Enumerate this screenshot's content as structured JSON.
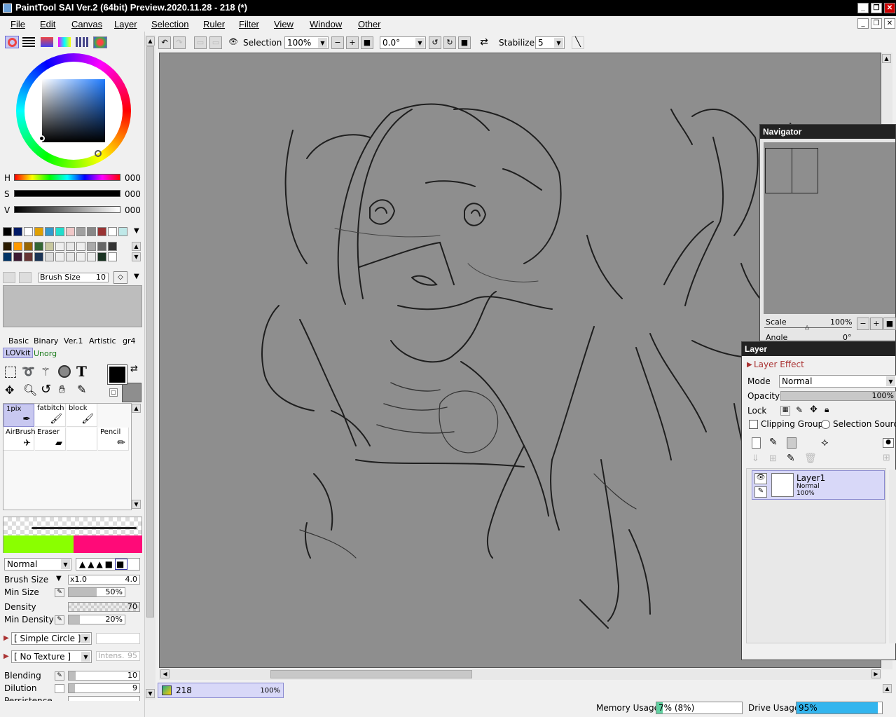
{
  "window": {
    "title": "PaintTool SAI Ver.2 (64bit) Preview.2020.11.28 - 218 (*)"
  },
  "menu": [
    "File",
    "Edit",
    "Canvas",
    "Layer",
    "Selection",
    "Ruler",
    "Filter",
    "View",
    "Window",
    "Other"
  ],
  "toolbar": {
    "selection_label": "Selection",
    "zoom": "100%",
    "rotation": "0.0°",
    "stabilizer_label": "Stabilizer",
    "stabilizer_value": "5"
  },
  "color": {
    "h_label": "H",
    "s_label": "S",
    "v_label": "V",
    "h_value": "000",
    "s_value": "000",
    "v_value": "000"
  },
  "palette_row1": [
    "#000000",
    "#001a66",
    "#ffffff",
    "#e0a000",
    "#3399cc",
    "#22ddcc",
    "#f0c8c8",
    "#a0a0a0",
    "#888888",
    "#993333",
    "#ffffff",
    "#bfe8e8"
  ],
  "palette_row2": [
    "#2a1a00",
    "#ff9900",
    "#996600",
    "#336633",
    "#c8c8a0",
    "#eeeeee",
    "#e8e8e8",
    "#eeeeee",
    "#aaaaaa",
    "#666666",
    "#333333"
  ],
  "palette_row3": [
    "#003366",
    "#3c1a33",
    "#663333",
    "#1a3355",
    "#dddddd",
    "#eeeeee",
    "#e8e8e8",
    "#eeeeee",
    "#eeeeee",
    "#1a3322",
    "#ffffff"
  ],
  "brush_panel": {
    "brush_size_label": "Brush Size",
    "brush_size_value": "10"
  },
  "brush_tabs": [
    "Basic",
    "Binary",
    "Ver.1",
    "Artistic",
    "gr4",
    "LOVkit",
    "Unorg"
  ],
  "brushes": [
    {
      "name": "1pix",
      "icon": "pen-icon"
    },
    {
      "name": "fatbitch",
      "icon": "brush-icon"
    },
    {
      "name": "block",
      "icon": "brush-icon"
    },
    {
      "name": "AirBrush",
      "icon": "airbrush-icon"
    },
    {
      "name": "Eraser",
      "icon": "eraser-icon"
    },
    {
      "name": "",
      "icon": ""
    },
    {
      "name": "Pencil",
      "icon": "pencil-icon"
    }
  ],
  "brush_settings": {
    "blend_mode": "Normal",
    "brush_size_label": "Brush Size",
    "brush_size_mult": "x1.0",
    "brush_size_value": "4.0",
    "min_size_label": "Min Size",
    "min_size_value": "50%",
    "min_size_level": 0.5,
    "density_label": "Density",
    "density_value": "70",
    "min_density_label": "Min Density",
    "min_density_value": "20%",
    "min_density_level": 0.2,
    "shape": "[ Simple Circle ]",
    "texture": "[ No Texture ]",
    "texture_intens_label": "Intens.",
    "texture_intens_value": "95",
    "blending_label": "Blending",
    "blending_value": "10",
    "dilution_label": "Dilution",
    "dilution_value": "9",
    "persistence_label": "Persistence"
  },
  "colors": {
    "fg": "#000000",
    "bg": "#8e8e8e",
    "mix_left": "#8aff00",
    "mix_right": "#ff0a78",
    "accent": "#c8c8f0"
  },
  "status": {
    "doc_name": "218",
    "doc_zoom": "100%",
    "memory_label": "Memory Usage",
    "memory_value": "7% (8%)",
    "memory_level": 0.07,
    "drive_label": "Drive Usage",
    "drive_value": "95%",
    "drive_level": 0.95
  },
  "navigator": {
    "title": "Navigator",
    "scale_label": "Scale",
    "scale_value": "100%",
    "angle_label": "Angle",
    "angle_value": "0°"
  },
  "layer_panel": {
    "title": "Layer",
    "effect_label": "Layer Effect",
    "mode_label": "Mode",
    "mode_value": "Normal",
    "opacity_label": "Opacity",
    "opacity_value": "100%",
    "lock_label": "Lock",
    "clipping_label": "Clipping Group",
    "selection_source_label": "Selection Source",
    "layers": [
      {
        "name": "Layer1",
        "mode": "Normal",
        "opacity": "100%"
      }
    ]
  }
}
